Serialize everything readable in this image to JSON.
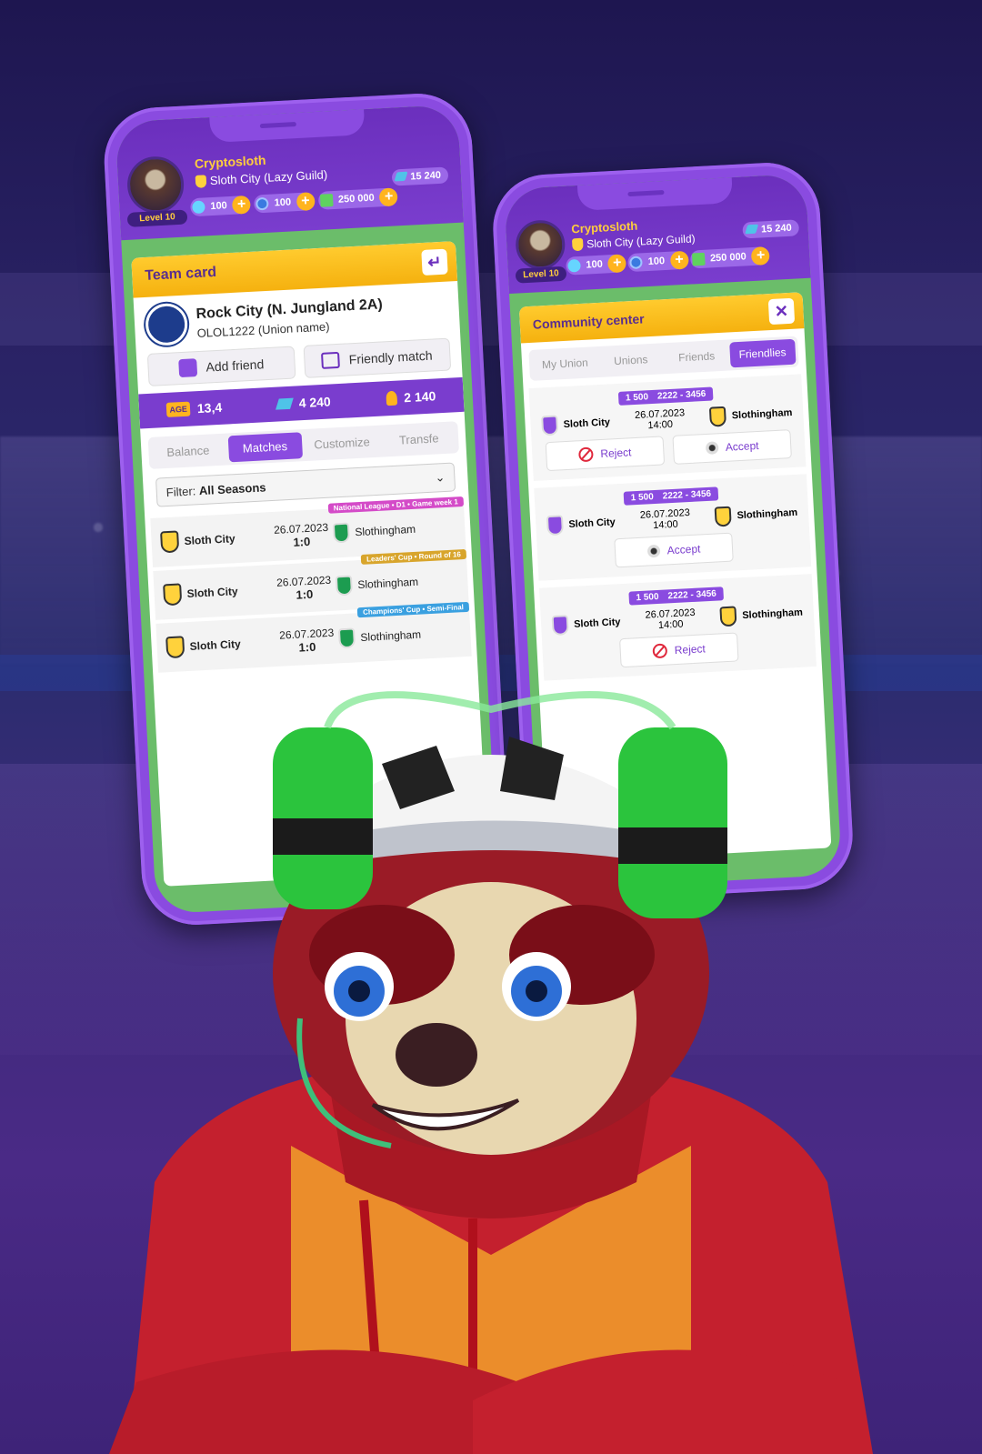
{
  "player": {
    "username": "Cryptosloth",
    "guild": "Sloth City (Lazy Guild)",
    "level": "Level 10",
    "boosts": "15 240",
    "gems": "100",
    "coins": "100",
    "cash": "250 000"
  },
  "team_card": {
    "title": "Team card",
    "team_name": "Rock City (N. Jungland 2A)",
    "union_name": "OLOL1222 (Union name)",
    "add_friend": "Add friend",
    "friendly_match": "Friendly match",
    "stats": {
      "age_label": "AGE",
      "age": "13,4",
      "boosts": "4 240",
      "rewards": "2 140"
    },
    "tabs": [
      "Balance",
      "Matches",
      "Customize",
      "Transfe"
    ],
    "active_tab": "Matches",
    "filter_label": "Filter:",
    "filter_value": "All Seasons",
    "matches": [
      {
        "home": "Sloth City",
        "date": "26.07.2023",
        "score": "1:0",
        "away": "Slothingham",
        "competition": "National League • D1 • Game week 1",
        "comp_color": "#d44bc8"
      },
      {
        "home": "Sloth City",
        "date": "26.07.2023",
        "score": "1:0",
        "away": "Slothingham",
        "competition": "Leaders' Cup • Round of 16",
        "comp_color": "#d8a52c"
      },
      {
        "home": "Sloth City",
        "date": "26.07.2023",
        "score": "1:0",
        "away": "Slothingham",
        "competition": "Champions' Cup • Semi-Final",
        "comp_color": "#3aa0e0"
      }
    ]
  },
  "community": {
    "title": "Community center",
    "tabs": [
      "My Union",
      "Unions",
      "Friends",
      "Friendlies"
    ],
    "active_tab": "Friendlies",
    "friendlies": [
      {
        "stake": "1 500",
        "range": "2222 - 3456",
        "home": "Sloth City",
        "date": "26.07.2023",
        "time": "14:00",
        "away": "Slothingham",
        "reject": "Reject",
        "accept": "Accept"
      },
      {
        "stake": "1 500",
        "range": "2222 - 3456",
        "home": "Sloth City",
        "date": "26.07.2023",
        "time": "14:00",
        "away": "Slothingham",
        "accept": "Accept"
      },
      {
        "stake": "1 500",
        "range": "2222 - 3456",
        "home": "Sloth City",
        "date": "26.07.2023",
        "time": "14:00",
        "away": "Slothingham",
        "reject": "Reject"
      }
    ]
  }
}
